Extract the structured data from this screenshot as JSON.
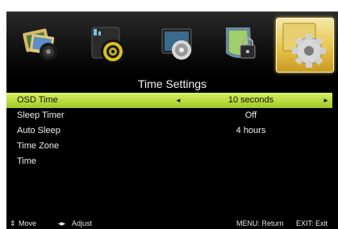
{
  "menu_icons": [
    {
      "name": "picture-menu-icon",
      "selected": false
    },
    {
      "name": "sound-menu-icon",
      "selected": false
    },
    {
      "name": "channel-menu-icon",
      "selected": false
    },
    {
      "name": "lock-menu-icon",
      "selected": false
    },
    {
      "name": "setup-gear-menu-icon",
      "selected": true
    }
  ],
  "title": "Time Settings",
  "items": [
    {
      "label": "OSD Time",
      "value": "10 seconds",
      "selected": true
    },
    {
      "label": "Sleep Timer",
      "value": "Off",
      "selected": false
    },
    {
      "label": "Auto Sleep",
      "value": "4 hours",
      "selected": false
    },
    {
      "label": "Time Zone",
      "value": "",
      "selected": false
    },
    {
      "label": "Time",
      "value": "",
      "selected": false
    }
  ],
  "selection_arrows": {
    "left": "◄",
    "right": "►"
  },
  "footer": {
    "move_icon": "⇕",
    "move_label": "Move",
    "adjust_icon": "◂▸",
    "adjust_label": "Adjust",
    "menu_hint": "MENU: Return",
    "exit_hint": "EXIT: Exit"
  },
  "colors": {
    "background": "#000000",
    "highlight": "#c0e050",
    "text": "#eeeeee",
    "highlight_text": "#111111"
  }
}
